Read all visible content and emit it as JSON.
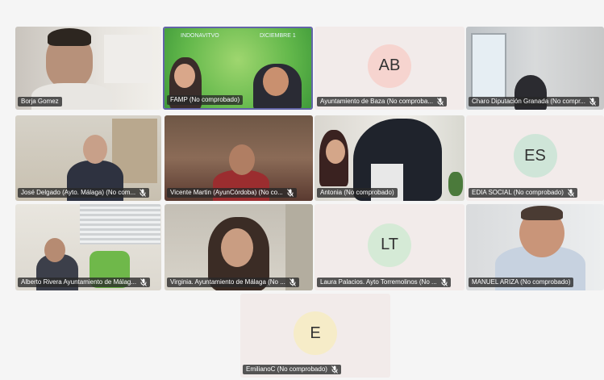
{
  "colors": {
    "background": "#f5f5f5",
    "avatar_tile": "#f2ebea",
    "active_speaker_border": "#6264a7"
  },
  "participants": [
    {
      "name": "Borja Gomez",
      "muted": false
    },
    {
      "name": "FAMP (No comprobado)",
      "muted": false,
      "active": true,
      "banner_left": "INDONAVITVO",
      "banner_right": "DICIEMBRE 1"
    },
    {
      "name": "Ayuntamiento de Baza (No comproba...",
      "muted": true,
      "initials": "AB",
      "avatar_color": "#f6d4cf"
    },
    {
      "name": "Charo Diputación Granada (No compr...",
      "muted": true
    },
    {
      "name": "José Delgado (Ayto. Málaga) (No com...",
      "muted": true
    },
    {
      "name": "Vicente Martin (AyunCórdoba) (No co...",
      "muted": true
    },
    {
      "name": "Antonia (No comprobado)",
      "muted": false
    },
    {
      "name": "EDIA SOCIAL (No comprobado)",
      "muted": true,
      "initials": "ES",
      "avatar_color": "#cfe5d8"
    },
    {
      "name": "Alberto Rivera Ayuntamiento de Málag...",
      "muted": true
    },
    {
      "name": "Virginia. Ayuntamiento de Málaga (No ...",
      "muted": true
    },
    {
      "name": "Laura Palacios. Ayto Torremolinos (No ...",
      "muted": true,
      "initials": "LT",
      "avatar_color": "#d5ead6"
    },
    {
      "name": "MANUEL ARIZA (No comprobado)",
      "muted": false
    },
    {
      "name": "EmilianoC (No comprobado)",
      "muted": true,
      "initials": "E",
      "avatar_color": "#f6ecc8"
    }
  ]
}
